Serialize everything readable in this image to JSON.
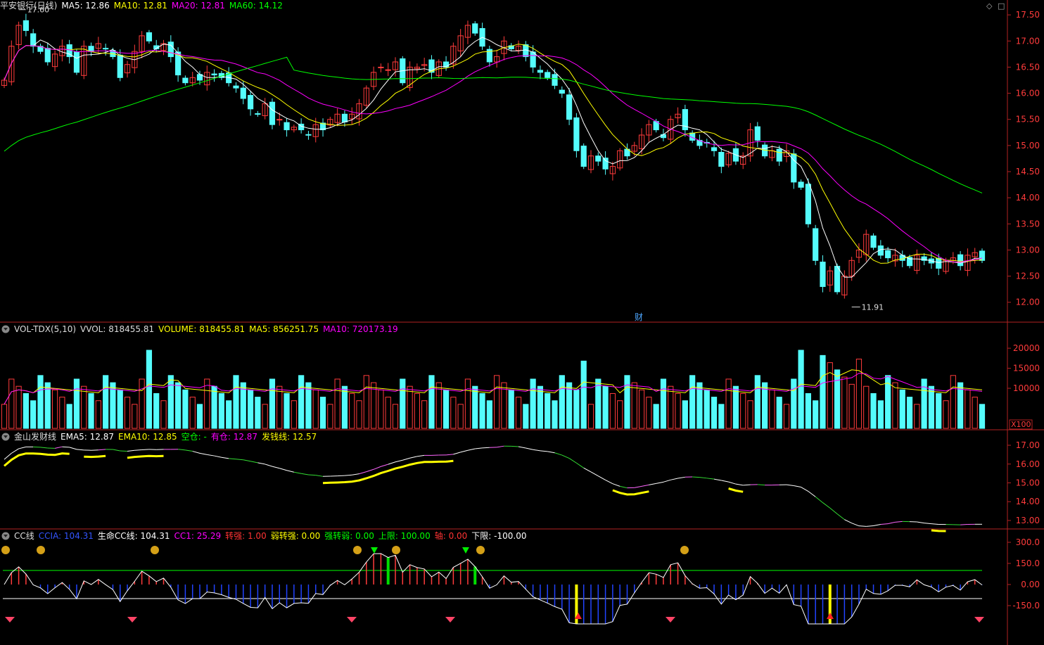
{
  "main": {
    "title": "平安银行(日线)",
    "ma": [
      {
        "label": "MA5: 12.86",
        "color": "#ffffff"
      },
      {
        "label": "MA10: 12.81",
        "color": "#ffff00"
      },
      {
        "label": "MA20: 12.81",
        "color": "#ff00ff"
      },
      {
        "label": "MA60: 14.12",
        "color": "#00ff00"
      }
    ],
    "y_ticks": [
      "17.50",
      "17.00",
      "16.50",
      "16.00",
      "15.50",
      "15.00",
      "14.50",
      "14.00",
      "13.50",
      "13.00",
      "12.50",
      "12.00"
    ],
    "y_range": [
      11.7,
      17.65
    ],
    "high_label": "17.60",
    "low_label": "11.91",
    "cai_label": "财",
    "icons": [
      "diamond-icon",
      "maximize-icon"
    ]
  },
  "volume": {
    "title": "VOL-TDX(5,10)",
    "fields": [
      {
        "label": "VVOL: 818455.81",
        "color": "#dddddd"
      },
      {
        "label": "VOLUME: 818455.81",
        "color": "#ffff00"
      },
      {
        "label": "MA5: 856251.75",
        "color": "#ffff00"
      },
      {
        "label": "MA10: 720173.19",
        "color": "#ff00ff"
      }
    ],
    "y_ticks": [
      "20000",
      "15000",
      "10000"
    ],
    "unit": "X100"
  },
  "jinshan": {
    "title": "金山发财线",
    "fields": [
      {
        "label": "EMA5: 12.87",
        "color": "#ffffff"
      },
      {
        "label": "EMA10: 12.85",
        "color": "#ffff00"
      },
      {
        "label": "空仓: -",
        "color": "#00ff00"
      },
      {
        "label": "有仓: 12.87",
        "color": "#ff00ff"
      },
      {
        "label": "发钱线: 12.57",
        "color": "#ffff00"
      }
    ],
    "y_ticks": [
      "17.00",
      "16.00",
      "15.00",
      "14.00",
      "13.00"
    ]
  },
  "cc": {
    "title": "CC线",
    "fields": [
      {
        "label": "CCIA: 104.31",
        "color": "#3355ff"
      },
      {
        "label": "生命CC线: 104.31",
        "color": "#ffffff"
      },
      {
        "label": "CC1: 25.29",
        "color": "#ff00ff"
      },
      {
        "label": "转强: 1.00",
        "color": "#ff3333"
      },
      {
        "label": "弱转强: 0.00",
        "color": "#ffff00"
      },
      {
        "label": "强转弱: 0.00",
        "color": "#00ff00"
      },
      {
        "label": "上限: 100.00",
        "color": "#00ff00"
      },
      {
        "label": "轴: 0.00",
        "color": "#ff3333"
      },
      {
        "label": "下限: -100.00",
        "color": "#ffffff"
      }
    ],
    "y_ticks": [
      "300.0",
      "150.0",
      "0.00",
      "-150.0"
    ]
  }
}
